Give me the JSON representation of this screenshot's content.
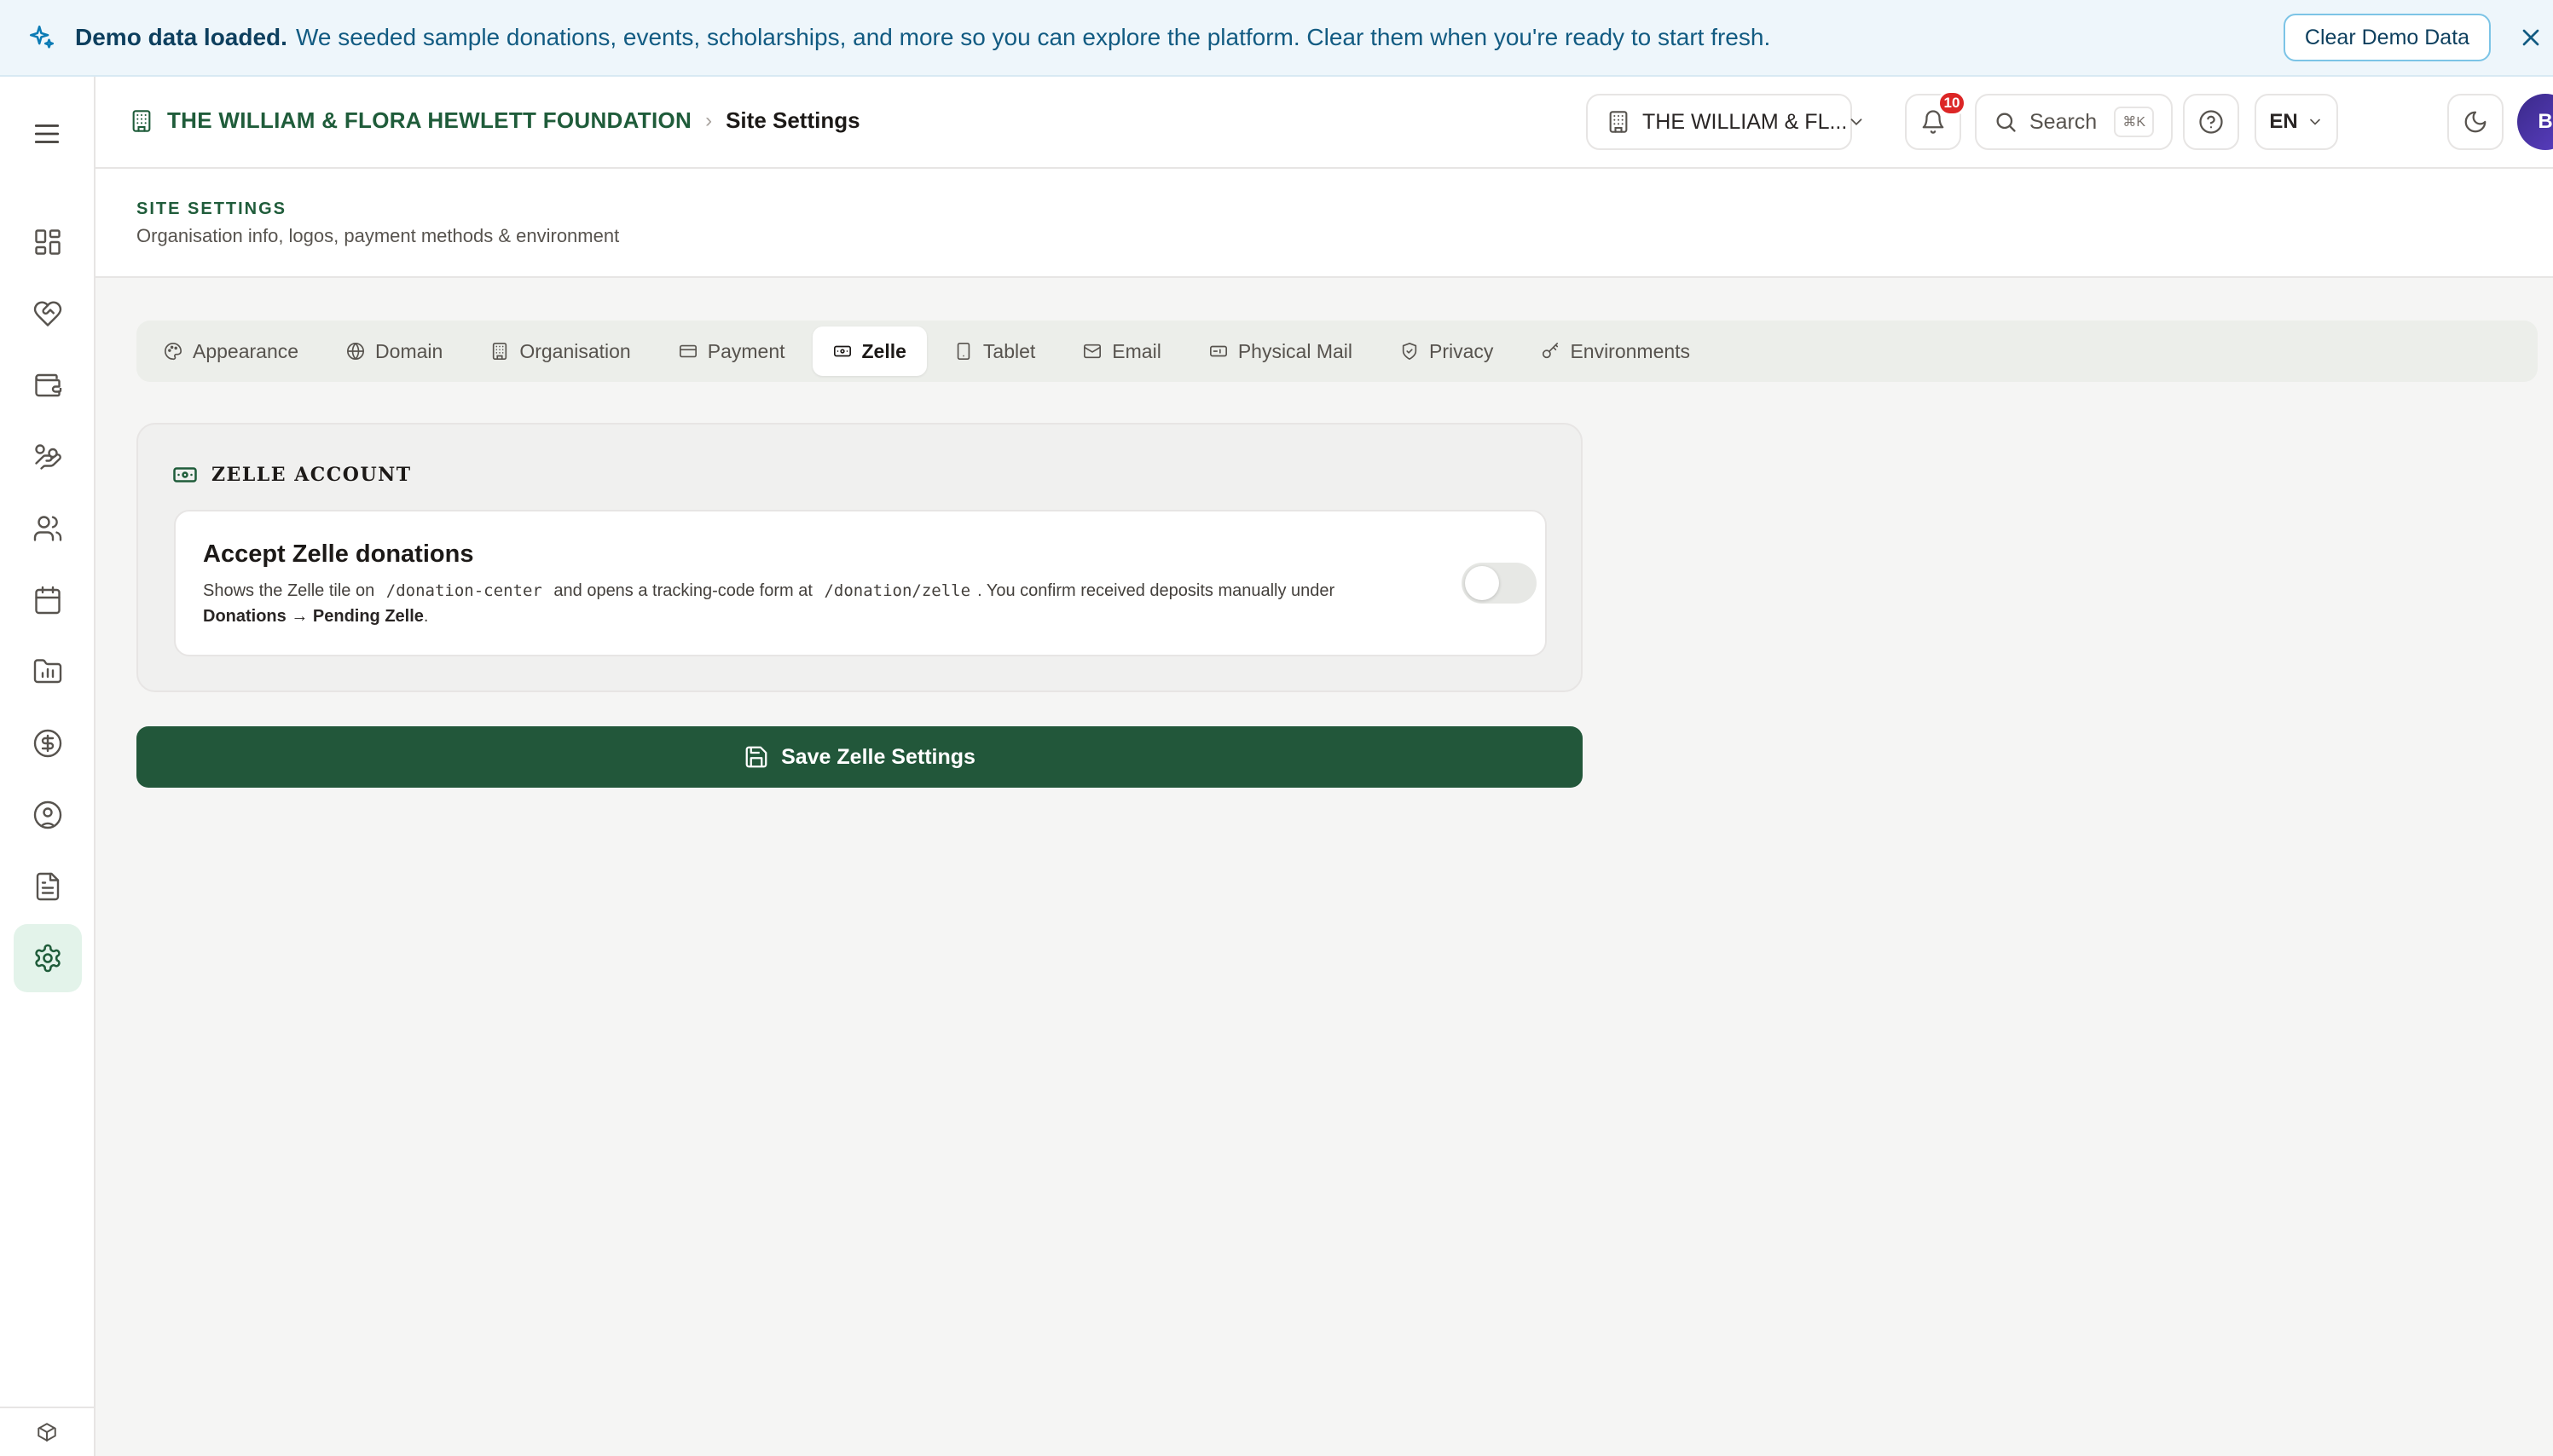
{
  "banner": {
    "title": "Demo data loaded.",
    "message": "We seeded sample donations, events, scholarships, and more so you can explore the platform. Clear them when you're ready to start fresh.",
    "clear_label": "Clear Demo Data"
  },
  "header": {
    "org_name": "THE WILLIAM & FLORA HEWLETT FOUNDATION",
    "breadcrumb_separator": "›",
    "current_page": "Site Settings",
    "org_selector": "THE WILLIAM & FL...",
    "notifications_count": "10",
    "search_placeholder": "Search",
    "search_shortcut": "⌘K",
    "language": "EN",
    "avatar_initial": "B"
  },
  "page": {
    "eyebrow": "SITE SETTINGS",
    "subtitle": "Organisation info, logos, payment methods & environment"
  },
  "tabs": [
    {
      "label": "Appearance",
      "icon": "palette-icon"
    },
    {
      "label": "Domain",
      "icon": "globe-icon"
    },
    {
      "label": "Organisation",
      "icon": "building-icon"
    },
    {
      "label": "Payment",
      "icon": "credit-card-icon"
    },
    {
      "label": "Zelle",
      "icon": "banknote-icon",
      "active": true
    },
    {
      "label": "Tablet",
      "icon": "tablet-icon"
    },
    {
      "label": "Email",
      "icon": "mail-icon"
    },
    {
      "label": "Physical Mail",
      "icon": "mailbox-icon"
    },
    {
      "label": "Privacy",
      "icon": "shield-icon"
    },
    {
      "label": "Environments",
      "icon": "key-icon"
    }
  ],
  "zelle": {
    "section_title": "ZELLE ACCOUNT",
    "toggle_title": "Accept Zelle donations",
    "desc_part1": "Shows the Zelle tile on",
    "desc_code1": "/donation-center",
    "desc_part2": "and opens a tracking-code form at",
    "desc_code2": "/donation/zelle",
    "desc_part3": ". You confirm received deposits manually under",
    "desc_bold": "Donations → Pending Zelle",
    "desc_end": ".",
    "enabled": false,
    "save_label": "Save Zelle Settings"
  },
  "colors": {
    "brand": "#22573a",
    "banner_bg": "#eef6fb",
    "badge": "#dc2626"
  }
}
